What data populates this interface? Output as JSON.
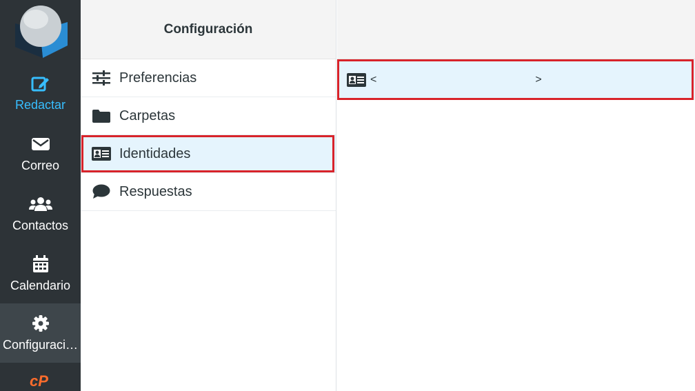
{
  "nav": {
    "items": [
      {
        "label": "Redactar",
        "icon": "compose-icon"
      },
      {
        "label": "Correo",
        "icon": "envelope-icon"
      },
      {
        "label": "Contactos",
        "icon": "users-icon"
      },
      {
        "label": "Calendario",
        "icon": "calendar-icon"
      },
      {
        "label": "Configuraci…",
        "icon": "gear-icon"
      }
    ],
    "compose_color": "#37beff",
    "background": "#2d3337"
  },
  "settings": {
    "title": "Configuración",
    "items": [
      {
        "label": "Preferencias",
        "icon": "sliders-icon"
      },
      {
        "label": "Carpetas",
        "icon": "folder-icon"
      },
      {
        "label": "Identidades",
        "icon": "id-card-icon"
      },
      {
        "label": "Respuestas",
        "icon": "comment-icon"
      }
    ],
    "selected_index": 2
  },
  "identities": {
    "rows": [
      {
        "open": "<",
        "close": ">"
      }
    ]
  },
  "highlight_color": "#d8232a",
  "selection_color": "#e5f4fd"
}
